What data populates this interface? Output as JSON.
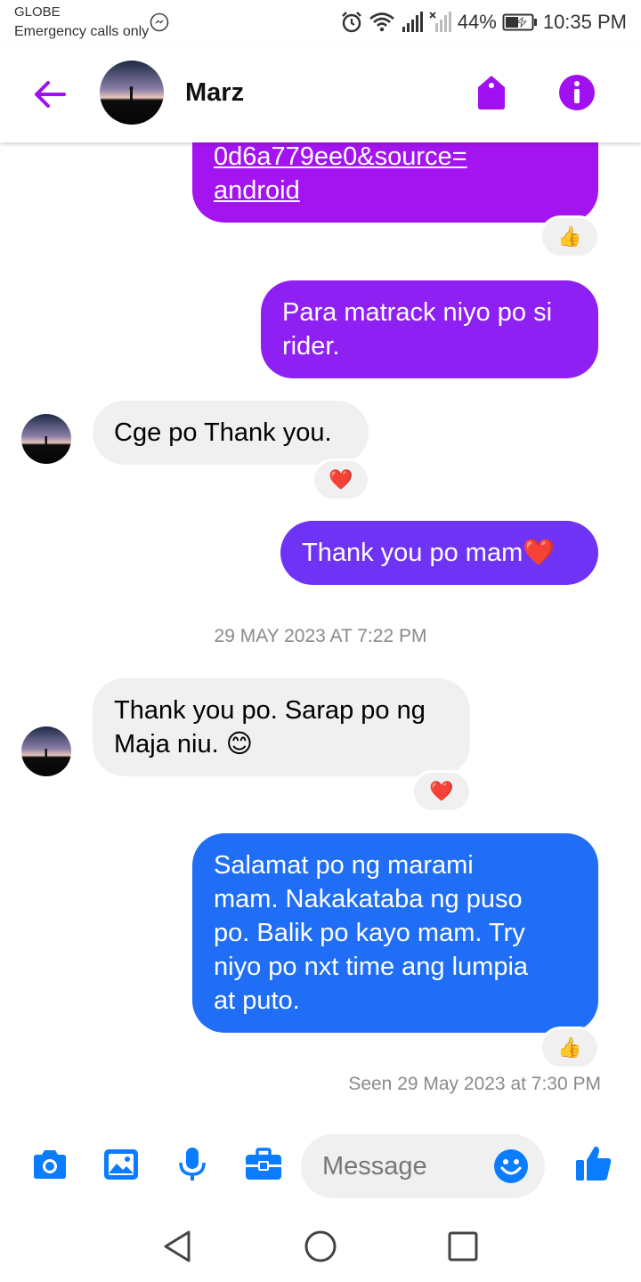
{
  "status_bar": {
    "carrier": "GLOBE",
    "emergency": "Emergency calls only",
    "battery": "44%",
    "time": "10:35 PM",
    "icons": [
      "messenger-icon",
      "alarm-icon",
      "wifi-icon",
      "signal-icon",
      "no-signal-icon",
      "battery-charging-icon"
    ]
  },
  "header": {
    "contact_name": "Marz",
    "icons": [
      "back-arrow-icon",
      "tag-icon",
      "info-icon"
    ]
  },
  "messages": [
    {
      "direction": "outgoing",
      "line1": "0d6a779ee0&source=",
      "line2": "android",
      "is_link": true,
      "reaction": "👍"
    },
    {
      "direction": "outgoing",
      "line1": "Para matrack niyo po si",
      "line2": "rider."
    },
    {
      "direction": "incoming",
      "text": "Cge po Thank you.",
      "reaction": "❤️"
    },
    {
      "direction": "outgoing",
      "text": "Thank you po mam❤️"
    },
    {
      "direction": "incoming",
      "line1": "Thank you po. Sarap po ng",
      "line2": "Maja niu. 😊",
      "reaction": "❤️"
    },
    {
      "direction": "outgoing",
      "line1": "Salamat po ng marami",
      "line2": "mam. Nakakataba ng puso",
      "line3": "po. Balik po kayo mam. Try",
      "line4": "niyo po nxt time ang lumpia",
      "line5": "at puto.",
      "reaction": "👍"
    }
  ],
  "timestamp": "29 MAY 2023 AT 7:22 PM",
  "seen": "Seen 29 May 2023 at 7:30 PM",
  "composer": {
    "placeholder": "Message",
    "icons": [
      "camera-icon",
      "gallery-icon",
      "microphone-icon",
      "briefcase-icon",
      "emoji-icon",
      "thumbs-up-icon"
    ]
  },
  "nav_bar": {
    "icons": [
      "back-triangle-icon",
      "home-circle-icon",
      "recents-square-icon"
    ]
  },
  "colors": {
    "accent_purple": "#a010f0",
    "bubble_purple_top": "#9b16f2",
    "bubble_purple_mid": "#7a2cf6",
    "bubble_blue": "#1f6ef5",
    "messenger_blue": "#0a7cff",
    "incoming_bubble": "#f0f0f0"
  }
}
